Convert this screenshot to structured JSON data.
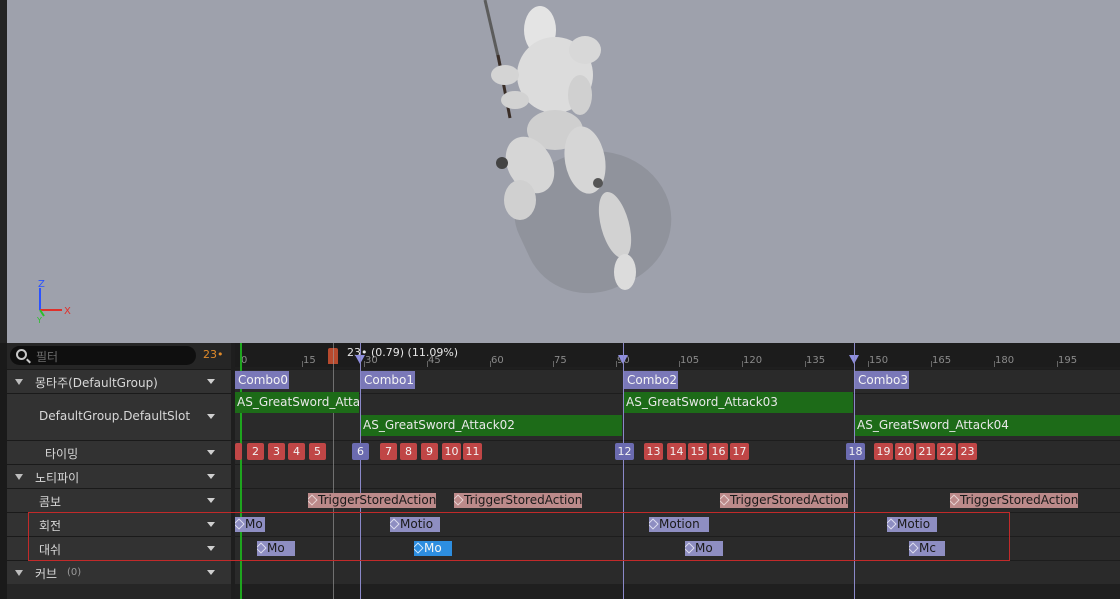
{
  "filter": {
    "placeholder": "필터",
    "frame": "23•"
  },
  "tracks": {
    "montage": "몽타주(DefaultGroup)",
    "slot": "DefaultGroup.DefaultSlot",
    "timing": "타이밍",
    "notify": "노티파이",
    "combo": "콤보",
    "rotation": "회전",
    "dash": "대쉬",
    "curve": "커브",
    "curve_count": "(0)"
  },
  "ruler": {
    "ticks": [
      "0",
      "15",
      "30",
      "45",
      "60",
      "75",
      "90",
      "105",
      "120",
      "135",
      "150",
      "165",
      "180",
      "195"
    ],
    "playhead": "23• (0.79) (11.09%)"
  },
  "sections": [
    "Combo0",
    "Combo1",
    "Combo2",
    "Combo3"
  ],
  "animations": [
    "AS_GreatSword_Attac",
    "AS_GreatSword_Attack02",
    "AS_GreatSword_Attack03",
    "AS_GreatSword_Attack04"
  ],
  "timing_markers": [
    "2",
    "3",
    "4",
    "5",
    "6",
    "7",
    "8",
    "9",
    "10",
    "11",
    "12",
    "13",
    "14",
    "15",
    "16",
    "17",
    "18",
    "19",
    "20",
    "21",
    "22",
    "23"
  ],
  "notifies": {
    "combo": [
      "TriggerStoredAction",
      "TriggerStoredAction",
      "TriggerStoredAction",
      "TriggerStoredAction"
    ],
    "rotation": [
      "Mo",
      "Motio",
      "Motion",
      "Motio"
    ],
    "dash": [
      "Mo",
      "Mo",
      "Mo",
      "Mc"
    ]
  },
  "viewport": {
    "axis_z": "Z",
    "axis_x": "X",
    "axis_y": "Y"
  },
  "colors": {
    "playhead": "#b74a2e",
    "section": "#7a78b8",
    "animation": "#1d6b18",
    "timing": "#c04646",
    "notify": "#bc8a8a",
    "selected": "#2d8ee0",
    "highlight_box": "#c22a2a"
  }
}
